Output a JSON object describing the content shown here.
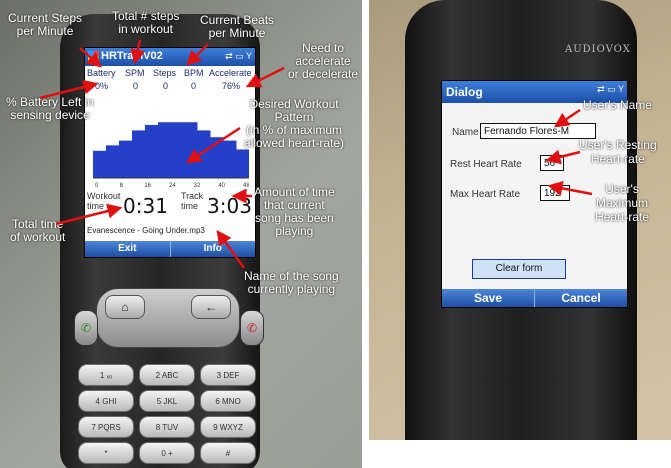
{
  "left_app": {
    "title": "HRTrainV02",
    "stat_headers": [
      "Battery",
      "SPM",
      "Steps",
      "BPM",
      "Accelerate"
    ],
    "stat_values": [
      "0%",
      "0",
      "0",
      "0",
      "76%"
    ],
    "x_ticks": [
      "0",
      "8",
      "16",
      "24",
      "32",
      "40",
      "48"
    ],
    "workout_label_line1": "Workout",
    "workout_label_line2": "time",
    "workout_time": "0:31",
    "track_label_line1": "Track",
    "track_label_line2": "time",
    "track_time": "3:03",
    "song": "Evanescence - Going Under.mp3",
    "softkey_left": "Exit",
    "softkey_right": "Info"
  },
  "chart_data": {
    "type": "bar",
    "description_axis": "x",
    "x_ticks": [
      "0",
      "8",
      "16",
      "24",
      "32",
      "40",
      "48"
    ],
    "x": [
      0,
      4,
      8,
      12,
      16,
      20,
      24,
      28,
      32,
      36,
      40,
      44
    ],
    "values": [
      40,
      48,
      55,
      70,
      78,
      82,
      82,
      82,
      70,
      60,
      55,
      42
    ],
    "ylim": [
      0,
      100
    ],
    "color": "#2440c8"
  },
  "left_annotations": {
    "current_spm": "Current Steps\nper Minute",
    "total_steps": "Total # steps\nin workout",
    "current_beats": "Current Beats\nper Minute",
    "need_accel": "Need to\naccelerate\nor decelerate",
    "battery": "% Battery Left in\nsensing device",
    "desired_pattern": "Desired Workout\nPattern\n(in % of maximum\nallowed heart-rate)",
    "track_time": "Amount of time\nthat current\nsong has been\nplaying",
    "total_time": "Total time\nof workout",
    "song_name": "Name of the song\ncurrently playing"
  },
  "keys": {
    "row1": [
      "1 ₓₒ",
      "2 ABC",
      "3 DEF"
    ],
    "row2": [
      "4 GHI",
      "5 JKL",
      "6 MNO"
    ],
    "row3": [
      "7 PQRS",
      "8 TUV",
      "9 WXYZ"
    ],
    "row4": [
      "*",
      "0 +",
      "#"
    ],
    "home": "⌂",
    "back": "←"
  },
  "right_app": {
    "brand": "AUDIOVOX",
    "title": "Dialog",
    "name_label": "Name",
    "name_value": "Fernando Flores-M",
    "rest_label": "Rest Heart Rate",
    "rest_value": "56",
    "max_label": "Max Heart Rate",
    "max_value": "192",
    "clear_button": "Clear form",
    "softkey_left": "Save",
    "softkey_right": "Cancel"
  },
  "right_annotations": {
    "users_name": "User's Name",
    "resting": "User's Resting\nHeart-rate",
    "maximum": "User's\nMaximum\nHeart-rate"
  }
}
